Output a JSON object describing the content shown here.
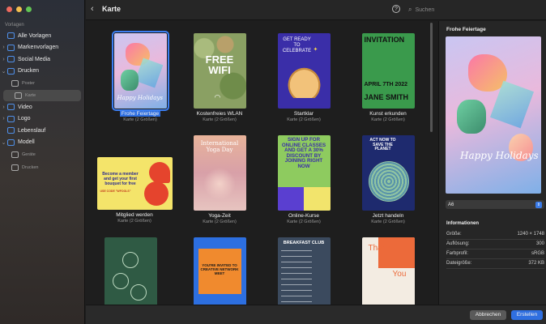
{
  "window": {
    "title": "Karte"
  },
  "sidebar": {
    "section_label": "Vorlagen",
    "items": [
      {
        "label": "Alle Vorlagen",
        "chevron": "",
        "level": 0
      },
      {
        "label": "Markenvorlagen",
        "chevron": "›",
        "level": 0
      },
      {
        "label": "Social Media",
        "chevron": "›",
        "level": 0
      },
      {
        "label": "Drucken",
        "chevron": "⌄",
        "level": 0
      },
      {
        "label": "Poster",
        "chevron": "",
        "level": 1
      },
      {
        "label": "Karte",
        "chevron": "",
        "level": 1,
        "selected": true
      },
      {
        "label": "Video",
        "chevron": "›",
        "level": 0
      },
      {
        "label": "Logo",
        "chevron": "›",
        "level": 0
      },
      {
        "label": "Lebenslauf",
        "chevron": "",
        "level": 0
      },
      {
        "label": "Modell",
        "chevron": "⌄",
        "level": 0
      },
      {
        "label": "Geräte",
        "chevron": "",
        "level": 1
      },
      {
        "label": "Drucken",
        "chevron": "",
        "level": 1
      }
    ]
  },
  "toolbar": {
    "back_icon": "chevron-left-icon",
    "help_label": "?",
    "search_placeholder": "Suchen"
  },
  "grid": {
    "tiles": [
      {
        "name": "Frohe Feiertage",
        "subtitle": "Karte (2 Größen)",
        "selected": true,
        "thumb_text": "Happy Holidays"
      },
      {
        "name": "Kostenfreies WLAN",
        "subtitle": "Karte (2 Größen)",
        "thumb_text": "FREE WIFI"
      },
      {
        "name": "Startklar",
        "subtitle": "Karte (2 Größen)",
        "thumb_text": "GET READY TO CELEBRATE"
      },
      {
        "name": "Kunst erkunden",
        "subtitle": "Karte (2 Größen)",
        "thumb_text": "INVITATION",
        "thumb_text2": "APRIL 7TH 2022",
        "thumb_text3": "JANE SMITH"
      },
      {
        "name": "Mitglied werden",
        "subtitle": "Karte (2 Größen)",
        "thumb_text": "Become a member and get your first bouquet for free",
        "thumb_text2": "USE CODE \"WFOOLS\""
      },
      {
        "name": "Yoga-Zeit",
        "subtitle": "Karte (2 Größen)",
        "thumb_text": "International Yoga Day"
      },
      {
        "name": "Online-Kurse",
        "subtitle": "Karte (2 Größen)",
        "thumb_text": "SIGN UP FOR ONLINE CLASSES AND GET A 30% DISCOUNT BY JOINING RIGHT NOW"
      },
      {
        "name": "Jetzt handeln",
        "subtitle": "Karte (2 Größen)",
        "thumb_text": "ACT NOW TO SAVE THE PLANET"
      },
      {
        "name": "",
        "subtitle": "",
        "thumb_text": ""
      },
      {
        "name": "",
        "subtitle": "",
        "thumb_text": "YOU'RE INVITED TO CREATIVE NETWORK MEET"
      },
      {
        "name": "",
        "subtitle": "",
        "thumb_text": "BREAKFAST CLUB"
      },
      {
        "name": "",
        "subtitle": "",
        "thumb_text": "Thank",
        "thumb_text2": "You"
      }
    ]
  },
  "inspector": {
    "title": "Frohe Feiertage",
    "preview_text": "Happy Holidays",
    "size_value": "A6",
    "info_heading": "Informationen",
    "rows": [
      {
        "label": "Größe:",
        "value": "1240 × 1748"
      },
      {
        "label": "Auflösung:",
        "value": "300"
      },
      {
        "label": "Farbprofil:",
        "value": "sRGB"
      },
      {
        "label": "Dateigröße:",
        "value": "372 KB"
      }
    ]
  },
  "footer": {
    "cancel_label": "Abbrechen",
    "create_label": "Erstellen"
  }
}
